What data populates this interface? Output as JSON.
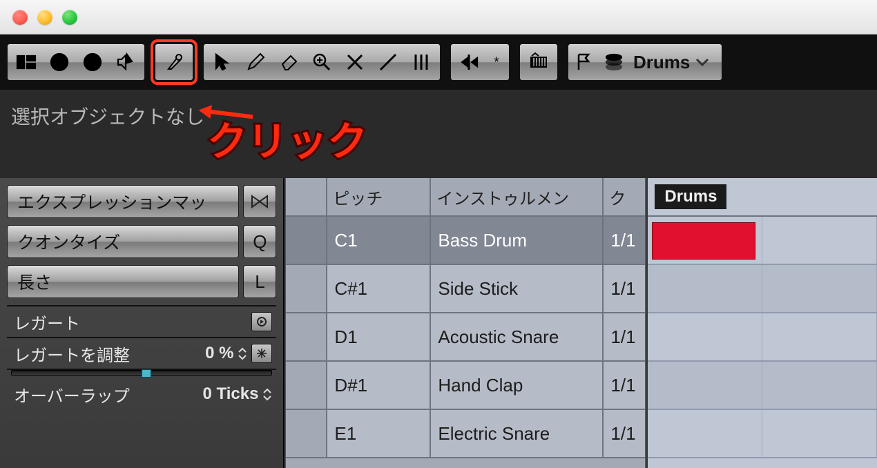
{
  "annotation": {
    "text": "クリック"
  },
  "info_line": "選択オブジェクトなし",
  "preset": {
    "label": "Drums"
  },
  "left_panel": {
    "sections": [
      {
        "label": "エクスプレッションマッ",
        "badge": "⋈"
      },
      {
        "label": "クオンタイズ",
        "badge": "Q"
      },
      {
        "label": "長さ",
        "badge": "L"
      }
    ],
    "params": [
      {
        "label": "レガート",
        "value": ""
      },
      {
        "label": "レガートを調整",
        "value": "0 %"
      },
      {
        "label": "オーバーラップ",
        "value": "0 Ticks"
      }
    ]
  },
  "drum_table": {
    "headers": [
      "",
      "ピッチ",
      "インストゥルメン",
      "ク"
    ],
    "rows": [
      {
        "pitch": "C1",
        "name": "Bass Drum",
        "q": "1/1",
        "selected": true
      },
      {
        "pitch": "C#1",
        "name": "Side Stick",
        "q": "1/1",
        "selected": false
      },
      {
        "pitch": "D1",
        "name": "Acoustic Snare",
        "q": "1/1",
        "selected": false
      },
      {
        "pitch": "D#1",
        "name": "Hand Clap",
        "q": "1/1",
        "selected": false
      },
      {
        "pitch": "E1",
        "name": "Electric Snare",
        "q": "1/1",
        "selected": false
      }
    ]
  },
  "drum_grid": {
    "label": "Drums"
  }
}
